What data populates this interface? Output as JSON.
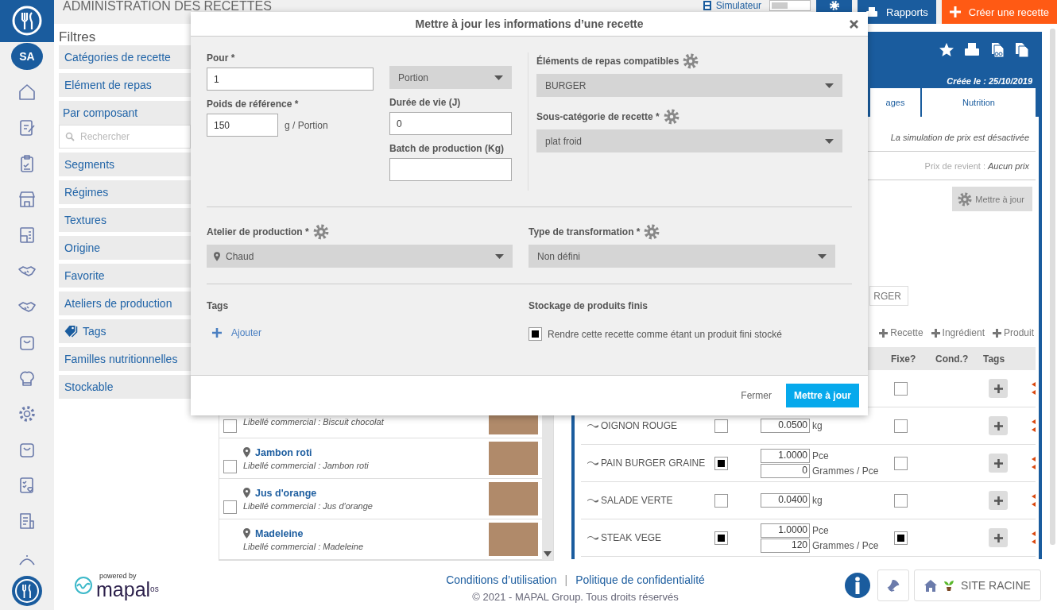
{
  "nav": {
    "avatar": "SA"
  },
  "header": {
    "title": "ADMINISTRATION DES RECETTES",
    "simulator": {
      "label": "Simulateur",
      "on": false
    },
    "buttons": [
      {
        "kind": "reports",
        "label": "Rapports"
      },
      {
        "kind": "create",
        "label": "Créer une recette"
      }
    ]
  },
  "filters": {
    "title": "Filtres",
    "items": [
      {
        "kind": "item",
        "label": "Catégories de recette"
      },
      {
        "kind": "item",
        "label": "Elément de repas"
      },
      {
        "kind": "search",
        "label": "Par composant",
        "placeholder": "Rechercher"
      },
      {
        "kind": "item",
        "label": "Segments"
      },
      {
        "kind": "item",
        "label": "Régimes"
      },
      {
        "kind": "item",
        "label": "Textures"
      },
      {
        "kind": "item",
        "label": "Origine"
      },
      {
        "kind": "item",
        "label": "Favorite"
      },
      {
        "kind": "item",
        "label": "Ateliers de production"
      },
      {
        "kind": "tag",
        "label": "Tags"
      },
      {
        "kind": "item",
        "label": "Familles nutritionnelles"
      },
      {
        "kind": "item",
        "label": "Stockable"
      }
    ]
  },
  "recipe_list": {
    "items": [
      {
        "subtitle": "Libellé commercial : Biscuit chocolat",
        "checked": false
      },
      {
        "name": "Jambon roti",
        "subtitle": "Libellé commercial : Jambon roti",
        "checked": false
      },
      {
        "name": "Jus d'orange",
        "subtitle": "Libellé commercial : Jus d'orange",
        "checked": false
      },
      {
        "name": "Madeleine",
        "subtitle": "Libellé commercial : Madeleine"
      }
    ]
  },
  "detail": {
    "created": "Créée le : 25/10/2019",
    "tabs": [
      {
        "label": "ages",
        "selected": false
      },
      {
        "label": "Nutrition",
        "selected": false
      }
    ],
    "price_simulation": "La simulation de prix est désactivée",
    "cost_label": "Prix de revient :",
    "cost_value": "Aucun prix",
    "update_button": "Mettre à jour",
    "chip": "RGER",
    "add_links": [
      "Recette",
      "Ingrédient",
      "Produit"
    ],
    "table": {
      "columns": [
        "Fixe?",
        "Cond.?",
        "Tags"
      ],
      "rows": [
        {
          "fixed": false
        },
        {
          "name": "OIGNON ROUGE",
          "checked": false,
          "quantities": [
            {
              "value": "0.0500",
              "unit": "kg"
            }
          ],
          "fixed": false
        },
        {
          "name": "PAIN BURGER GRAINE",
          "checked": true,
          "quantities": [
            {
              "value": "1.0000",
              "unit": "Pce"
            },
            {
              "value": "0",
              "unit": "Grammes / Pce"
            }
          ],
          "fixed": false
        },
        {
          "name": "SALADE VERTE",
          "checked": false,
          "quantities": [
            {
              "value": "0.0400",
              "unit": "kg"
            }
          ],
          "fixed": false
        },
        {
          "name": "STEAK VEGE",
          "checked": true,
          "quantities": [
            {
              "value": "1.0000",
              "unit": "Pce"
            },
            {
              "value": "120",
              "unit": "Grammes / Pce"
            }
          ],
          "fixed": true
        }
      ]
    }
  },
  "modal": {
    "title": "Mettre à jour les informations d’une recette",
    "pour": {
      "label": "Pour *",
      "value": "1"
    },
    "unit_select": "Portion",
    "reference_weight": {
      "label": "Poids de référence *",
      "value": "150",
      "unit": "g /  Portion"
    },
    "shelf_life": {
      "label": "Durée de vie (J)",
      "value": "0"
    },
    "batch": {
      "label": "Batch de production (Kg)"
    },
    "meal_elements": {
      "label": "Éléments de repas compatibles",
      "value": "BURGER"
    },
    "subcategory": {
      "label": "Sous-catégorie de recette *",
      "value": "plat froid"
    },
    "workshop": {
      "label": "Atelier de production *",
      "value": "Chaud"
    },
    "transformation": {
      "label": "Type de transformation *",
      "value": "Non défini"
    },
    "tags": {
      "label": "Tags",
      "add": "Ajouter"
    },
    "storage": {
      "label": "Stockage de produits finis",
      "checkbox_label": "Rendre cette recette comme étant un produit fini stocké",
      "checked": true
    },
    "buttons": {
      "close": "Fermer",
      "submit": "Mettre à jour"
    }
  },
  "footer": {
    "powered_by": "powered by",
    "brand": "mapal",
    "brand_suffix": "os",
    "links": [
      "Conditions d’utilisation",
      "Politique de confidentialité"
    ],
    "separator": "|",
    "copyright": "© 2021 - MAPAL Group. Tous droits réservés",
    "site": "SITE RACINE"
  }
}
